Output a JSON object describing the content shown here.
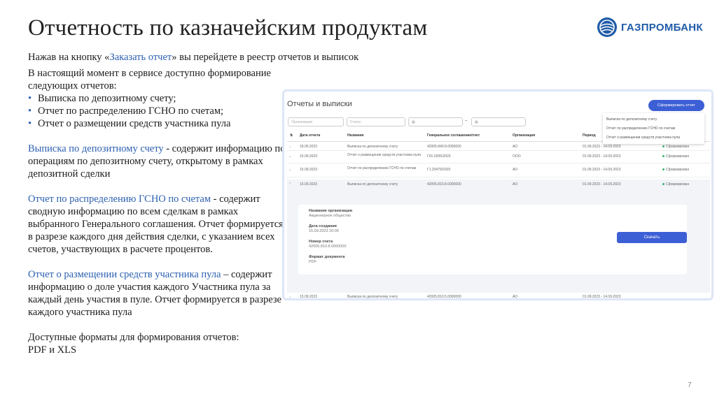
{
  "page": {
    "title": "Отчетность по казначейским продуктам",
    "page_number": "7"
  },
  "logo": {
    "text": "ГАЗПРОМБАНК",
    "brand_color": "#1f5ba8"
  },
  "intro": {
    "before": "Нажав на кнопку «",
    "link": "Заказать отчет",
    "after": "» вы перейдете в реестр отчетов и выписок"
  },
  "left": {
    "available": "В настоящий момент в сервисе доступно формирование следующих отчетов:",
    "bullets": [
      "Выписка по депозитному счету;",
      "Отчет по распределению ГСНО по счетам;",
      "Отчет о размещении средств участника пула"
    ],
    "p1_link": "Выписка по депозитному счету",
    "p1_text": " -  содержит информацию по операциям по депозитному счету, открытому в рамках депозитной сделки",
    "p2_link": "Отчет по распределению ГСНО по счетам",
    "p2_text": " - содержит сводную информацию по всем сделкам в рамках выбранного Генерального соглашения. Отчет формируется в разрезе каждого дня действия сделки, с указанием всех счетов, участвующих в расчете процентов.",
    "p3_link": "Отчет о размещении средств участника пула",
    "p3_text": " – содержит информацию о доле участия каждого Участника пула за каждый день участия в пуле. Отчет формируется в разрезе каждого участника пула",
    "formats_label": "Доступные форматы для формирования отчетов:",
    "formats": "PDF и XLS"
  },
  "screenshot": {
    "title": "Отчеты и выписки",
    "create_button": "Сформировать отчет",
    "dropdown": [
      "Выписка по депозитному счету",
      "Отчет по распределению ГСНО по счетам",
      "Отчет о размещении средств участника пула"
    ],
    "filters": {
      "organization": "Организация",
      "status": "Статус",
      "dash": "–"
    },
    "columns": [
      "Дата отчета",
      "Название",
      "Генеральное соглашение/счет",
      "Организация",
      "Период"
    ],
    "rows": [
      {
        "date": "18.09.2023",
        "name": "Выписка по депозитному счету",
        "account": "42005.840.8.0000000",
        "org": "АО",
        "period": "01.09.2023 - 14.09.2023",
        "status": "Сформирован"
      },
      {
        "date": "15.09.2023",
        "name": "Отчет о размещении средств участника пула",
        "account": "Г01-0205/2020",
        "org": "ООО",
        "period": "01.09.2023 - 14.09.2023",
        "status": "Сформирован"
      },
      {
        "date": "15.09.2023",
        "name": "Отчет по распределению ГСНО по счетам",
        "account": "Г1.20479/2020",
        "org": "АО",
        "period": "01.09.2023 - 14.09.2023",
        "status": "Сформирован"
      },
      {
        "date": "15.09.2023",
        "name": "Выписка по депозитному счету",
        "account": "42005.810.8.0000000",
        "org": "АО",
        "period": "01.09.2023 - 14.09.2023",
        "status": "Сформирован"
      }
    ],
    "details": {
      "org_label": "Название организации",
      "org_value": "Акционерное общество",
      "created_label": "Дата создания",
      "created_value": "15.09.2023 20:00",
      "account_label": "Номер счета",
      "account_value": "42005.810.8.0000000",
      "format_label": "Формат документа",
      "format_value": "PDF",
      "download_button": "Скачать"
    },
    "last_row": {
      "date": "15.09.2023",
      "name": "Выписка по депозитному счету",
      "account": "42005.810.5.0000000",
      "org": "АО",
      "period": "01.09.2023 - 14.09.2023"
    },
    "accent_color": "#3d5fd6",
    "status_color": "#3cb371"
  }
}
